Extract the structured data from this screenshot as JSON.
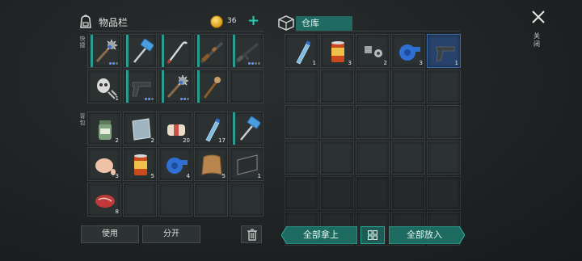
{
  "inventory": {
    "title": "物品栏",
    "coins": "36",
    "plus_label": "+",
    "quick_label": "快捷",
    "backpack_label": "背包",
    "use_button": "使用",
    "split_button": "分开"
  },
  "storage": {
    "title": "仓库",
    "take_all_button": "全部拿上",
    "put_all_button": "全部放入"
  },
  "close_label": "关闭",
  "colors": {
    "accent": "#2a9d8f",
    "selected_slot": "#27436b",
    "durability_teal": "#2a9d8f"
  },
  "quick_slots": [
    {
      "icon": "spiked-club-icon",
      "count": "",
      "dots": 3
    },
    {
      "icon": "sledgehammer-icon",
      "count": "",
      "dots": 0
    },
    {
      "icon": "crowbar-icon",
      "count": "",
      "dots": 0
    },
    {
      "icon": "shotgun-icon",
      "count": "",
      "dots": 0
    },
    {
      "icon": "assault-rifle-icon",
      "count": "",
      "dots": 4
    },
    {
      "icon": "skull-mask-icon",
      "count": "1",
      "dots": 0
    },
    {
      "icon": "pistol-icon",
      "count": "",
      "dots": 3
    },
    {
      "icon": "spiked-club-icon",
      "count": "",
      "dots": 3
    },
    {
      "icon": "torch-icon",
      "count": "",
      "dots": 0
    },
    {
      "icon": "",
      "count": "",
      "dots": 0
    }
  ],
  "backpack_slots": [
    {
      "icon": "pills-jar-icon",
      "count": "2"
    },
    {
      "icon": "glass-pane-icon",
      "count": "2"
    },
    {
      "icon": "bandage-icon",
      "count": "20"
    },
    {
      "icon": "water-bottle-icon",
      "count": "17"
    },
    {
      "icon": "sledgehammer-icon",
      "count": ""
    },
    {
      "icon": "raw-chicken-icon",
      "count": "3"
    },
    {
      "icon": "canned-food-icon",
      "count": "5"
    },
    {
      "icon": "duct-tape-icon",
      "count": "4"
    },
    {
      "icon": "leather-hide-icon",
      "count": "5"
    },
    {
      "icon": "tarp-icon",
      "count": "1"
    },
    {
      "icon": "raw-steak-icon",
      "count": "8"
    },
    {
      "icon": "",
      "count": ""
    },
    {
      "icon": "",
      "count": ""
    },
    {
      "icon": "",
      "count": ""
    },
    {
      "icon": "",
      "count": ""
    }
  ],
  "storage_slots": [
    {
      "icon": "water-bottle-icon",
      "count": "1"
    },
    {
      "icon": "canned-food-icon",
      "count": "3"
    },
    {
      "icon": "nuts-bolts-icon",
      "count": "2"
    },
    {
      "icon": "duct-tape-icon",
      "count": "3"
    },
    {
      "icon": "pistol-icon",
      "count": "1"
    }
  ]
}
